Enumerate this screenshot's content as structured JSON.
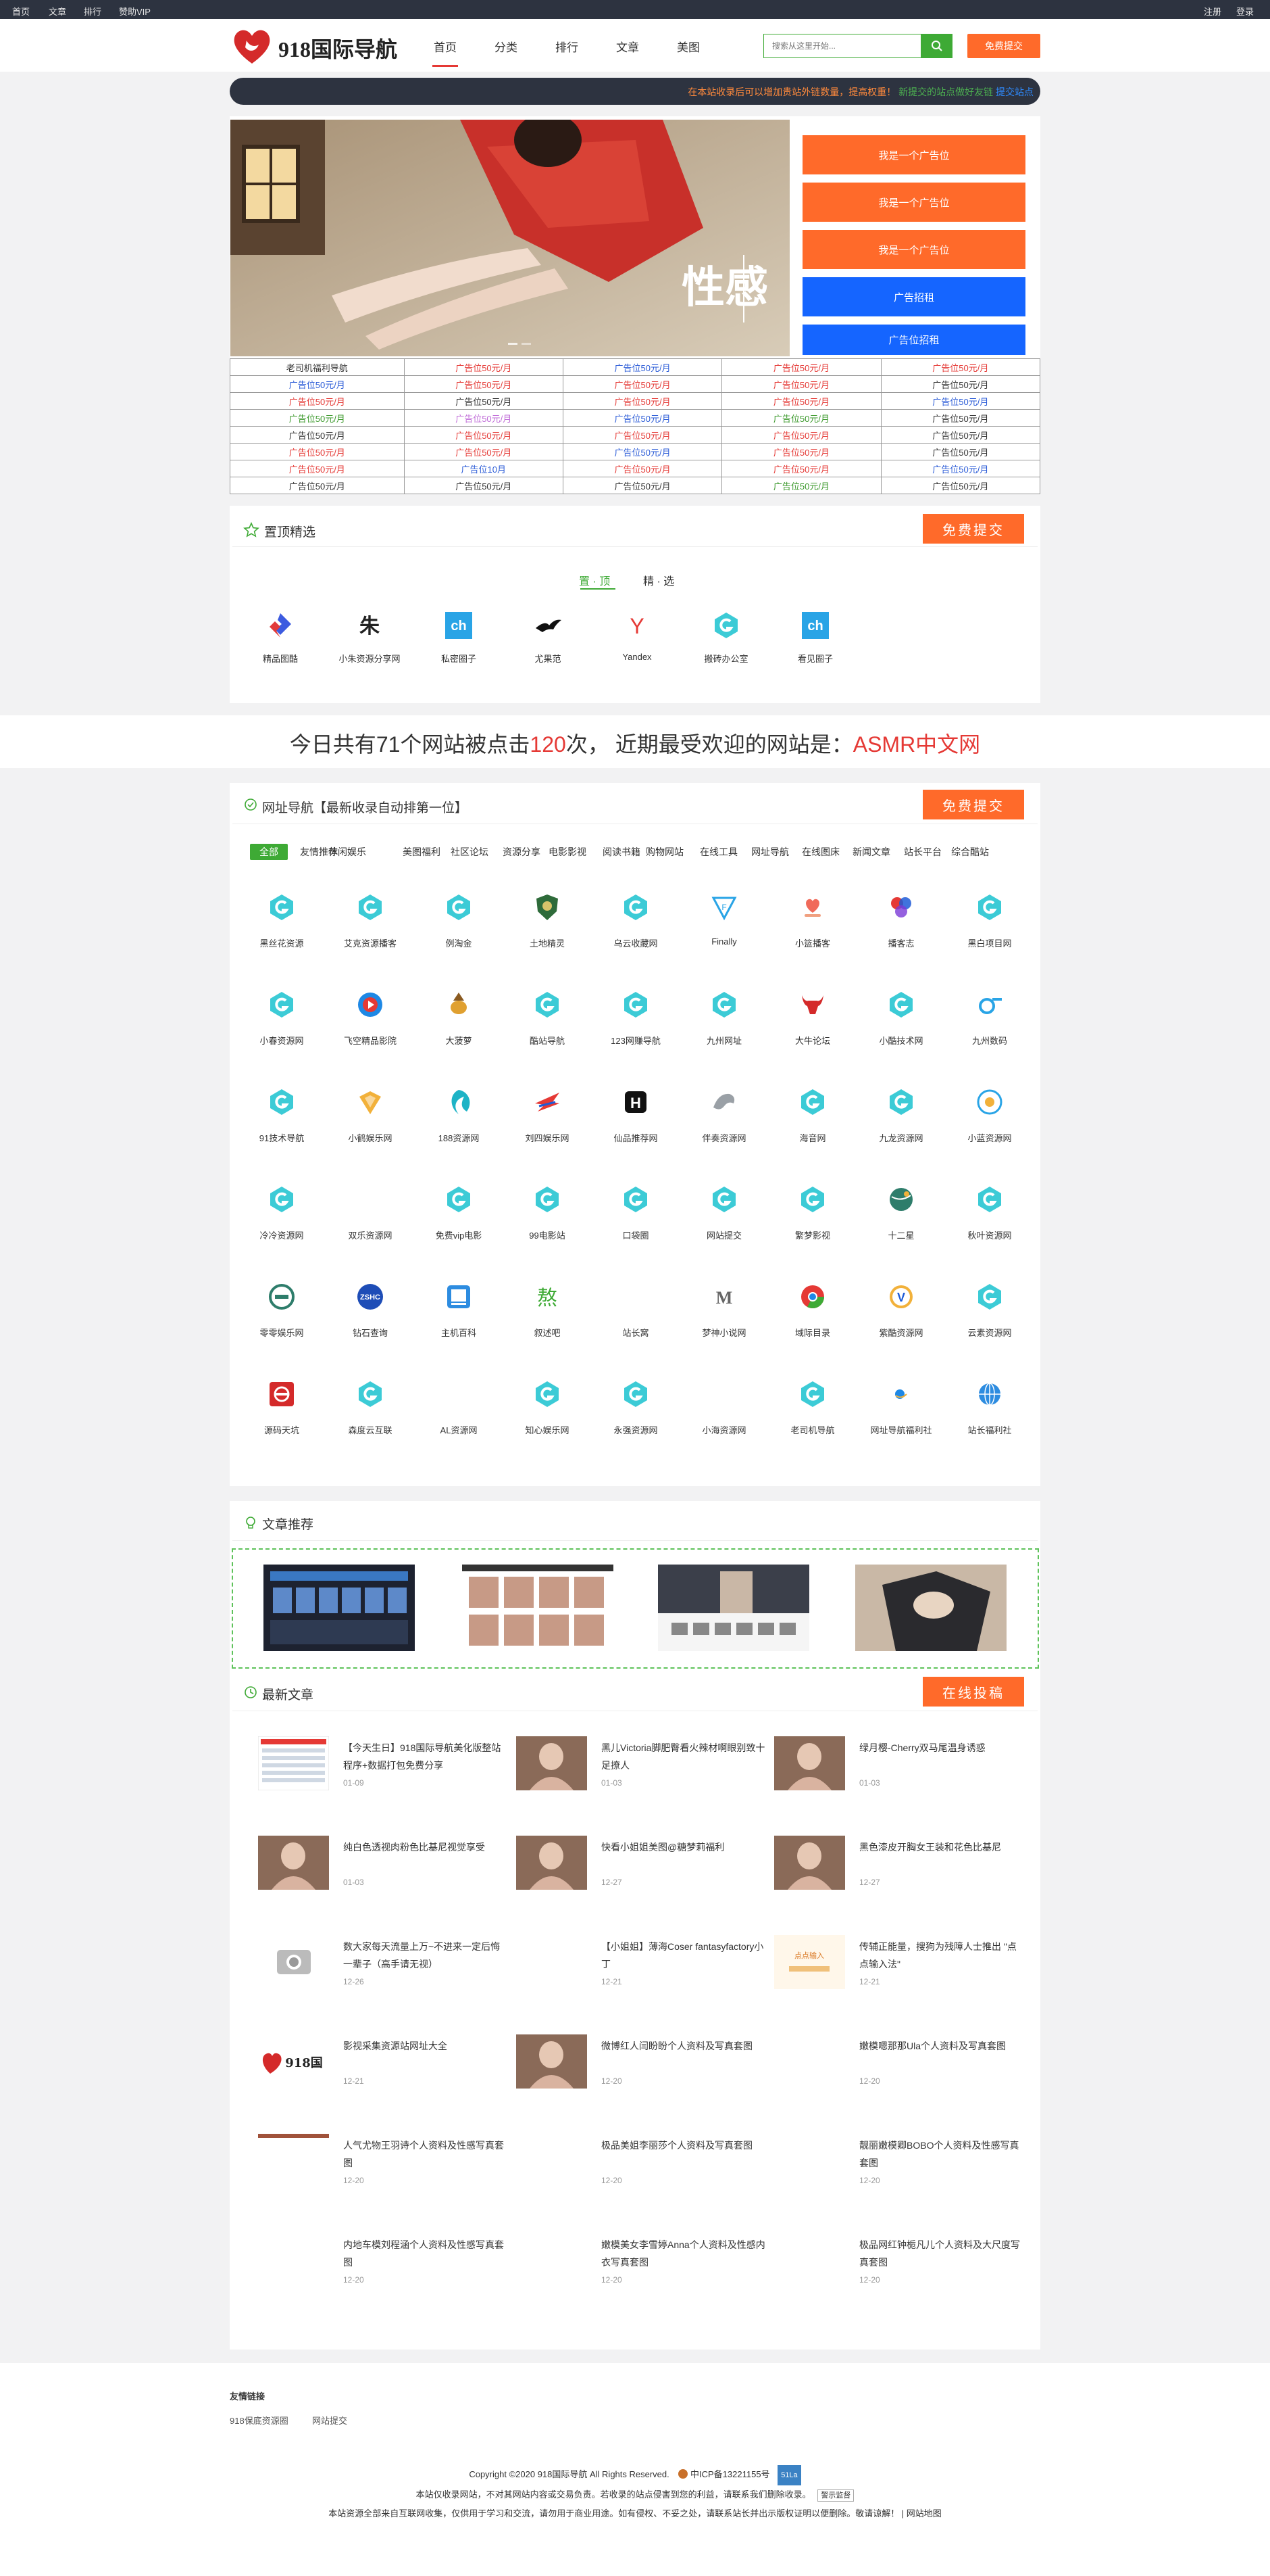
{
  "topbar": {
    "left": [
      "首页",
      "文章",
      "排行",
      "赞助VIP"
    ],
    "right": [
      "注册",
      "登录"
    ]
  },
  "header": {
    "logo_text": "918国际导航",
    "nav": [
      "首页",
      "分类",
      "排行",
      "文章",
      "美图"
    ],
    "search_placeholder": "搜索从这里开始...",
    "submit_label": "免费提交"
  },
  "notice": {
    "text1": "在本站收录后可以增加贵站外链数量，提高权重！",
    "text2": "新提交的站点做好友链",
    "text3": "提交站点"
  },
  "hero": {
    "banner_text": "性感",
    "ads": [
      "我是一个广告位",
      "我是一个广告位",
      "我是一个广告位",
      "广告招租",
      "广告位招租"
    ],
    "ad_colors": [
      "#ff6a2a",
      "#ff6a2a",
      "#ff6a2a",
      "#1565ff",
      "#1565ff"
    ]
  },
  "ad_table": [
    [
      {
        "t": "老司机福利导航",
        "c": "#333"
      },
      {
        "t": "广告位50元/月",
        "c": "#e53935"
      },
      {
        "t": "广告位50元/月",
        "c": "#2a5bd7"
      },
      {
        "t": "广告位50元/月",
        "c": "#e53935"
      },
      {
        "t": "广告位50元/月",
        "c": "#e53935"
      }
    ],
    [
      {
        "t": "广告位50元/月",
        "c": "#2a5bd7"
      },
      {
        "t": "广告位50元/月",
        "c": "#e53935"
      },
      {
        "t": "广告位50元/月",
        "c": "#e53935"
      },
      {
        "t": "广告位50元/月",
        "c": "#e53935"
      },
      {
        "t": "广告位50元/月",
        "c": "#333"
      }
    ],
    [
      {
        "t": "广告位50元/月",
        "c": "#e53935"
      },
      {
        "t": "广告位50元/月",
        "c": "#333"
      },
      {
        "t": "广告位50元/月",
        "c": "#e53935"
      },
      {
        "t": "广告位50元/月",
        "c": "#e53935"
      },
      {
        "t": "广告位50元/月",
        "c": "#2a5bd7"
      }
    ],
    [
      {
        "t": "广告位50元/月",
        "c": "#3e9a2e"
      },
      {
        "t": "广告位50元/月",
        "c": "#c06cd8"
      },
      {
        "t": "广告位50元/月",
        "c": "#2a5bd7"
      },
      {
        "t": "广告位50元/月",
        "c": "#3e9a2e"
      },
      {
        "t": "广告位50元/月",
        "c": "#333"
      }
    ],
    [
      {
        "t": "广告位50元/月",
        "c": "#333"
      },
      {
        "t": "广告位50元/月",
        "c": "#e53935"
      },
      {
        "t": "广告位50元/月",
        "c": "#e53935"
      },
      {
        "t": "广告位50元/月",
        "c": "#e53935"
      },
      {
        "t": "广告位50元/月",
        "c": "#333"
      }
    ],
    [
      {
        "t": "广告位50元/月",
        "c": "#e53935"
      },
      {
        "t": "广告位50元/月",
        "c": "#e53935"
      },
      {
        "t": "广告位50元/月",
        "c": "#2a5bd7"
      },
      {
        "t": "广告位50元/月",
        "c": "#e53935"
      },
      {
        "t": "广告位50元/月",
        "c": "#333"
      }
    ],
    [
      {
        "t": "广告位50元/月",
        "c": "#e53935"
      },
      {
        "t": "广告位10月",
        "c": "#2a5bd7"
      },
      {
        "t": "广告位50元/月",
        "c": "#e53935"
      },
      {
        "t": "广告位50元/月",
        "c": "#e53935"
      },
      {
        "t": "广告位50元/月",
        "c": "#2a5bd7"
      }
    ],
    [
      {
        "t": "广告位50元/月",
        "c": "#333"
      },
      {
        "t": "广告位50元/月",
        "c": "#333"
      },
      {
        "t": "广告位50元/月",
        "c": "#333"
      },
      {
        "t": "广告位50元/月",
        "c": "#3e9a2e"
      },
      {
        "t": "广告位50元/月",
        "c": "#333"
      }
    ]
  ],
  "top_picks": {
    "title": "置顶精选",
    "button": "免费提交",
    "tabs": [
      "置 · 顶",
      "精 · 选"
    ],
    "items": [
      {
        "label": "精品图酷",
        "icon": "blue-red-diamond-icon"
      },
      {
        "label": "小朱资源分享网",
        "icon": "zhu-calligraphy-icon"
      },
      {
        "label": "私密圈子",
        "icon": "ch-blue-square-icon"
      },
      {
        "label": "尤果范",
        "icon": "bird-silhouette-icon"
      },
      {
        "label": "Yandex",
        "icon": "yandex-y-icon"
      },
      {
        "label": "搬砖办公室",
        "icon": "teal-g-icon"
      },
      {
        "label": "看见圈子",
        "icon": "ch-blue-square-icon"
      }
    ]
  },
  "stats": {
    "p1": "今日共有",
    "n1": "71",
    "p2": "个网站被点击",
    "n2": "120",
    "p3": "次，  近期最受欢迎的网站是：",
    "site": "ASMR中文网"
  },
  "nav_section": {
    "title": "网址导航【最新收录自动排第一位】",
    "button": "免费提交",
    "categories": [
      "全部",
      "友情推荐",
      "休闲娱乐",
      "美图福利",
      "社区论坛",
      "资源分享",
      "电影影视",
      "阅读书籍",
      "购物网站",
      "在线工具",
      "网址导航",
      "在线图床",
      "新闻文章",
      "站长平台",
      "综合酷站"
    ],
    "rows": [
      [
        {
          "label": "黑丝花资源",
          "icon": "teal-g-icon"
        },
        {
          "label": "艾克资源播客",
          "icon": "teal-g-icon"
        },
        {
          "label": "例淘金",
          "icon": "teal-g-icon"
        },
        {
          "label": "土地精灵",
          "icon": "shield-emblem-icon"
        },
        {
          "label": "乌云收藏网",
          "icon": "teal-g-icon"
        },
        {
          "label": "Finally",
          "icon": "triangle-f-icon"
        },
        {
          "label": "小篮播客",
          "icon": "red-heart-hand-icon"
        },
        {
          "label": "播客志",
          "icon": "colorful-hex-icon"
        },
        {
          "label": "黑白项目网",
          "icon": "teal-g-icon"
        }
      ],
      [
        {
          "label": "小春资源网",
          "icon": "teal-g-icon"
        },
        {
          "label": "飞空精品影院",
          "icon": "play-orb-icon"
        },
        {
          "label": "大菠萝",
          "icon": "pineapple-icon"
        },
        {
          "label": "酷站导航",
          "icon": "teal-g-icon"
        },
        {
          "label": "123网赚导航",
          "icon": "teal-g-icon"
        },
        {
          "label": "九州网址",
          "icon": "teal-g-icon"
        },
        {
          "label": "大牛论坛",
          "icon": "bull-head-icon"
        },
        {
          "label": "小酷技术网",
          "icon": "teal-g-icon"
        },
        {
          "label": "九州数码",
          "icon": "blue-n-icon"
        }
      ],
      [
        {
          "label": "91技术导航",
          "icon": "teal-g-icon"
        },
        {
          "label": "小鹤娱乐网",
          "icon": "yellow-crest-icon"
        },
        {
          "label": "188资源网",
          "icon": "teal-swirl-icon"
        },
        {
          "label": "刘四娱乐网",
          "icon": "red-wing-icon"
        },
        {
          "label": "仙品推荐网",
          "icon": "black-h-icon"
        },
        {
          "label": "伴奏资源网",
          "icon": "dragon-icon"
        },
        {
          "label": "海音网",
          "icon": "teal-g-icon"
        },
        {
          "label": "九龙资源网",
          "icon": "teal-g-icon"
        },
        {
          "label": "小蓝资源网",
          "icon": "blue-circle-p-icon"
        }
      ],
      [
        {
          "label": "冷冷资源网",
          "icon": "teal-g-icon"
        },
        {
          "label": "双乐资源网",
          "icon": "none"
        },
        {
          "label": "免费vip电影",
          "icon": "teal-g-icon"
        },
        {
          "label": "99电影站",
          "icon": "teal-g-icon"
        },
        {
          "label": "口袋圈",
          "icon": "teal-g-icon"
        },
        {
          "label": "网站提交",
          "icon": "teal-g-icon"
        },
        {
          "label": "繁梦影视",
          "icon": "teal-g-icon"
        },
        {
          "label": "十二星",
          "icon": "green-globe-icon"
        },
        {
          "label": "秋叶资源网",
          "icon": "teal-g-icon"
        }
      ],
      [
        {
          "label": "零零娱乐网",
          "icon": "teal-ring-icon"
        },
        {
          "label": "钻石查询",
          "icon": "zshc-badge-icon"
        },
        {
          "label": "主机百科",
          "icon": "blue-card-icon"
        },
        {
          "label": "叙述吧",
          "icon": "green-glyph-icon"
        },
        {
          "label": "站长窝",
          "icon": "none"
        },
        {
          "label": "梦神小说网",
          "icon": "m-letter-icon"
        },
        {
          "label": "域际目录",
          "icon": "chrome-like-icon"
        },
        {
          "label": "紫酷资源网",
          "icon": "v-circle-icon"
        },
        {
          "label": "云素资源网",
          "icon": "teal-g-icon"
        }
      ],
      [
        {
          "label": "源码天坑",
          "icon": "red-square-icon"
        },
        {
          "label": "森度云互联",
          "icon": "teal-g-icon"
        },
        {
          "label": "AL资源网",
          "icon": "none"
        },
        {
          "label": "知心娱乐网",
          "icon": "teal-g-icon"
        },
        {
          "label": "永强资源网",
          "icon": "teal-g-icon"
        },
        {
          "label": "小海资源网",
          "icon": "none"
        },
        {
          "label": "老司机导航",
          "icon": "teal-g-icon"
        },
        {
          "label": "网址导航福利社",
          "icon": "small-blue-dot-icon"
        },
        {
          "label": "站长福利社",
          "icon": "blue-globe-icon"
        }
      ]
    ]
  },
  "article_recommend": {
    "title": "文章推荐"
  },
  "latest": {
    "title": "最新文章",
    "button": "在线投稿",
    "items": [
      {
        "title": "【今天生日】918国际导航美化版整站程序+数据打包免费分享",
        "date": "01-09",
        "thumb": "screenshot"
      },
      {
        "title": "黑儿Victoria脚肥臀看火辣材啊眼别致十足撩人",
        "date": "01-03",
        "thumb": "photo"
      },
      {
        "title": "绿月樱-Cherry双马尾温身诱惑",
        "date": "01-03",
        "thumb": "photo"
      },
      {
        "title": "纯白色透视肉粉色比基尼视觉享受",
        "date": "01-03",
        "thumb": "photo"
      },
      {
        "title": "快看小姐姐美图@糖梦莉福利",
        "date": "12-27",
        "thumb": "photo"
      },
      {
        "title": "黑色漆皮开胸女王装和花色比基尼",
        "date": "12-27",
        "thumb": "photo"
      },
      {
        "title": "数大家每天流量上万~不进来一定后悔一辈子（高手请无视）",
        "date": "12-26",
        "thumb": "camera"
      },
      {
        "title": "【小姐姐】薄海Coser fantasyfactory小丁",
        "date": "12-21",
        "thumb": "none"
      },
      {
        "title": "传辅正能量，搜狗为残障人士推出 \"点点输入法\"",
        "date": "12-21",
        "thumb": "poster"
      },
      {
        "title": "影视采集资源站网址大全",
        "date": "12-21",
        "thumb": "logo"
      },
      {
        "title": "微博红人闫盼盼个人资料及写真套图",
        "date": "12-20",
        "thumb": "photo"
      },
      {
        "title": "嫩模嗯那那Ula个人资料及写真套图",
        "date": "12-20",
        "thumb": "none"
      },
      {
        "title": "人气尤物王羽诗个人资料及性感写真套图",
        "date": "12-20",
        "thumb": "strip"
      },
      {
        "title": "极品美姐李丽莎个人资料及写真套图",
        "date": "12-20",
        "thumb": "none"
      },
      {
        "title": "靓丽嫩模卿BOBO个人资料及性感写真套图",
        "date": "12-20",
        "thumb": "none"
      },
      {
        "title": "内地车模刘程涵个人资料及性感写真套图",
        "date": "12-20",
        "thumb": "none"
      },
      {
        "title": "嫩模美女李雪婷Anna个人资料及性感内衣写真套图",
        "date": "12-20",
        "thumb": "none"
      },
      {
        "title": "极品网红钟栀凡儿个人资料及大尺度写真套图",
        "date": "12-20",
        "thumb": "none"
      }
    ]
  },
  "footer": {
    "links_title": "友情链接",
    "links": [
      "918保底资源圈",
      "网站提交"
    ],
    "copyright": "Copyright ©2020 918国际导航     All Rights Reserved.",
    "icp": "中ICP备13221155号",
    "badge": "51La",
    "line2": "本站仅收录网站，不对其网站内容或交易负责。若收录的站点侵害到您的利益，请联系我们删除收录。",
    "verify": "警示监督",
    "line3": "本站资源全部来自互联网收集，仅供用于学习和交流，请勿用于商业用途。如有侵权、不妥之处，请联系站长并出示版权证明以便删除。敬请谅解！ | 网站地图"
  }
}
